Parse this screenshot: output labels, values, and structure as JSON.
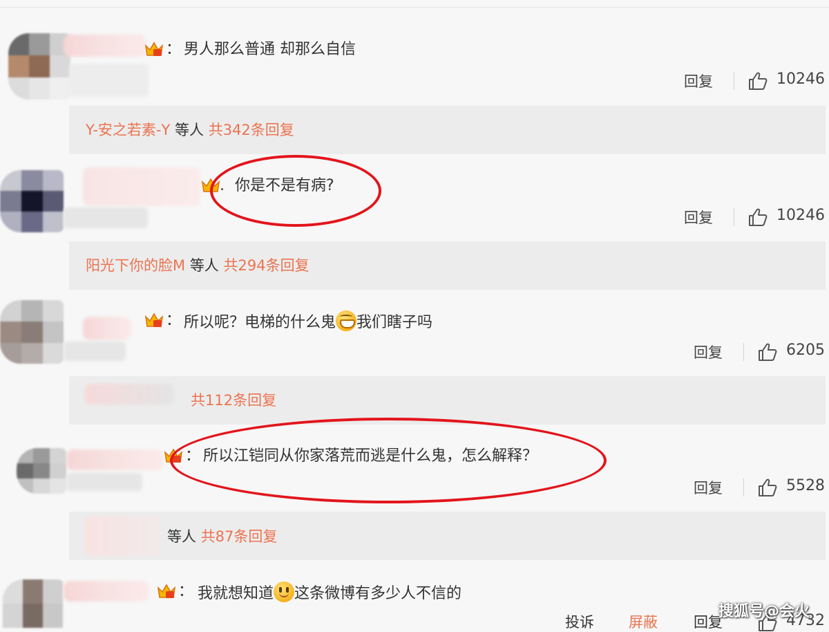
{
  "comments": [
    {
      "text": "男人那么普通 却那么自信",
      "reply_label": "回复",
      "likes": "10246",
      "replies": {
        "name": "Y-安之若素-Y",
        "others": "等人",
        "count": "共342条回复"
      }
    },
    {
      "text": "你是不是有病?",
      "reply_label": "回复",
      "likes": "10246",
      "replies": {
        "name": "阳光下你的脸M",
        "others": "等人",
        "count": "共294条回复"
      }
    },
    {
      "text_before": "所以呢？电梯的什么鬼",
      "text_after": "我们瞎子吗",
      "emoji": "grin-emoji",
      "reply_label": "回复",
      "likes": "6205",
      "replies": {
        "count": "共112条回复"
      }
    },
    {
      "text": "所以江铠同从你家落荒而逃是什么鬼，怎么解释？",
      "reply_label": "回复",
      "likes": "5528",
      "replies": {
        "others": "等人",
        "count": "共87条回复"
      }
    },
    {
      "text_before": "我就想知道",
      "text_after": "这条微博有多少人不信的",
      "emoji": "smile-emoji",
      "actions": [
        "投诉",
        "屏蔽",
        "回复"
      ],
      "likes": "4732"
    }
  ],
  "watermark": "搜狐号@会火",
  "colors": {
    "link": "#eb7350",
    "highlight_ring": "#e3141b",
    "background": "#f7f7f7",
    "reply_box": "#ececec"
  }
}
